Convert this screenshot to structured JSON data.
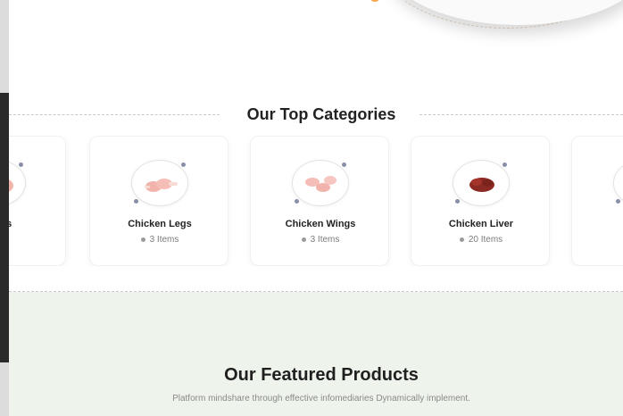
{
  "categories_section": {
    "title": "Our Top Categories",
    "cards": [
      {
        "name": "reasts",
        "count": "ms",
        "icon": "chicken-breast-image"
      },
      {
        "name": "Chicken Legs",
        "count": "3 Items",
        "icon": "chicken-legs-image"
      },
      {
        "name": "Chicken Wings",
        "count": "3 Items",
        "icon": "chicken-wings-image"
      },
      {
        "name": "Chicken Liver",
        "count": "20 Items",
        "icon": "chicken-liver-image"
      },
      {
        "name": "C",
        "count": "",
        "icon": "chicken-image"
      }
    ]
  },
  "featured_section": {
    "title": "Our Featured Products",
    "subtitle": "Platform mindshare through effective infomediaries Dynamically implement."
  },
  "colors": {
    "accent_orange": "#f7a64c",
    "featured_bg": "#eef3eb",
    "meat_pink": "#f2b3ad",
    "liver_red": "#8b2a22"
  }
}
